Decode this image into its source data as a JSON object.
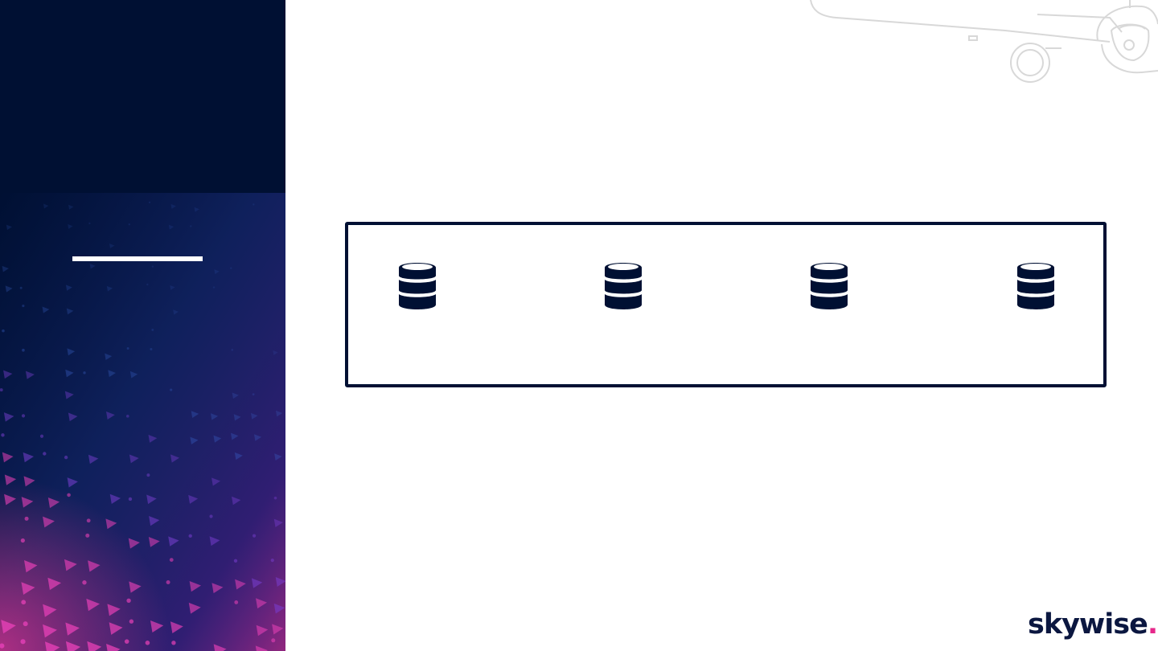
{
  "logo": {
    "text": "skywise",
    "dot": ".",
    "dot_color": "#e6278a"
  },
  "colors": {
    "panel_bg": "#001033",
    "accent": "#ffffff",
    "frame": "#001033",
    "pattern_blue": "#3b63c9",
    "pattern_purple": "#7a3fd1",
    "pattern_pink": "#e03fb3"
  },
  "icons": [
    {
      "name": "database-icon"
    },
    {
      "name": "database-icon"
    },
    {
      "name": "database-icon"
    },
    {
      "name": "database-icon"
    }
  ],
  "decorations": {
    "plane": "airplane-outline-graphic",
    "panel_pattern": "triangle-pattern-graphic"
  }
}
